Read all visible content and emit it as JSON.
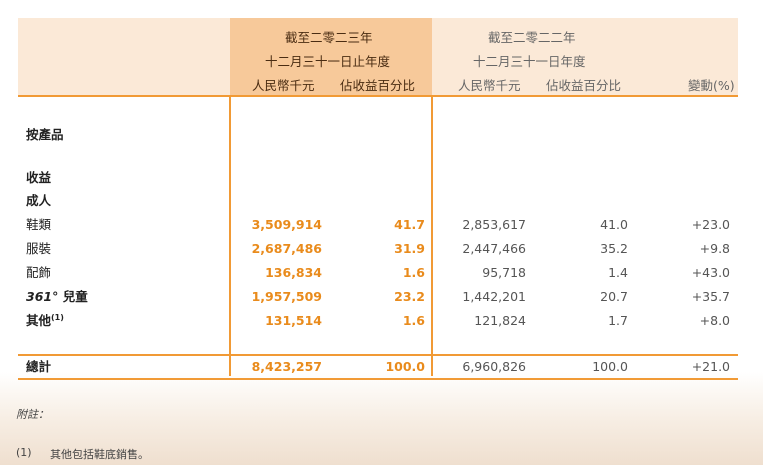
{
  "header": {
    "year2023_line1": "截至二零二三年",
    "year2023_line2": "十二月三十一日止年度",
    "year2022_line1": "截至二零二二年",
    "year2022_line2": "十二月三十一日年度",
    "col_rmb": "人民幣千元",
    "col_pct": "佔收益百分比",
    "col_change": "變動(%)"
  },
  "sections": {
    "by_product": "按產品",
    "revenue": "收益",
    "adult": "成人"
  },
  "rows": [
    {
      "label": "鞋類",
      "rmb_2023": "3,509,914",
      "pct_2023": "41.7",
      "rmb_2022": "2,853,617",
      "pct_2022": "41.0",
      "change": "+23.0"
    },
    {
      "label": "服裝",
      "rmb_2023": "2,687,486",
      "pct_2023": "31.9",
      "rmb_2022": "2,447,466",
      "pct_2022": "35.2",
      "change": "+9.8"
    },
    {
      "label": "配飾",
      "rmb_2023": "136,834",
      "pct_2023": "1.6",
      "rmb_2022": "95,718",
      "pct_2022": "1.4",
      "change": "+43.0"
    },
    {
      "label_brand": "361°",
      "label": "兒童",
      "rmb_2023": "1,957,509",
      "pct_2023": "23.2",
      "rmb_2022": "1,442,201",
      "pct_2022": "20.7",
      "change": "+35.7"
    },
    {
      "label": "其他",
      "sup": "(1)",
      "rmb_2023": "131,514",
      "pct_2023": "1.6",
      "rmb_2022": "121,824",
      "pct_2022": "1.7",
      "change": "+8.0"
    }
  ],
  "total": {
    "label": "總計",
    "rmb_2023": "8,423,257",
    "pct_2023": "100.0",
    "rmb_2022": "6,960,826",
    "pct_2022": "100.0",
    "change": "+21.0"
  },
  "notes": {
    "title": "附註：",
    "n1_marker": "(1)",
    "n1_text": "其他包括鞋底銷售。"
  },
  "colors": {
    "accent": "#f19a35",
    "highlight": "#f7c99a",
    "header_bg": "#fbe9d7",
    "value_orange": "#e98b1c"
  }
}
